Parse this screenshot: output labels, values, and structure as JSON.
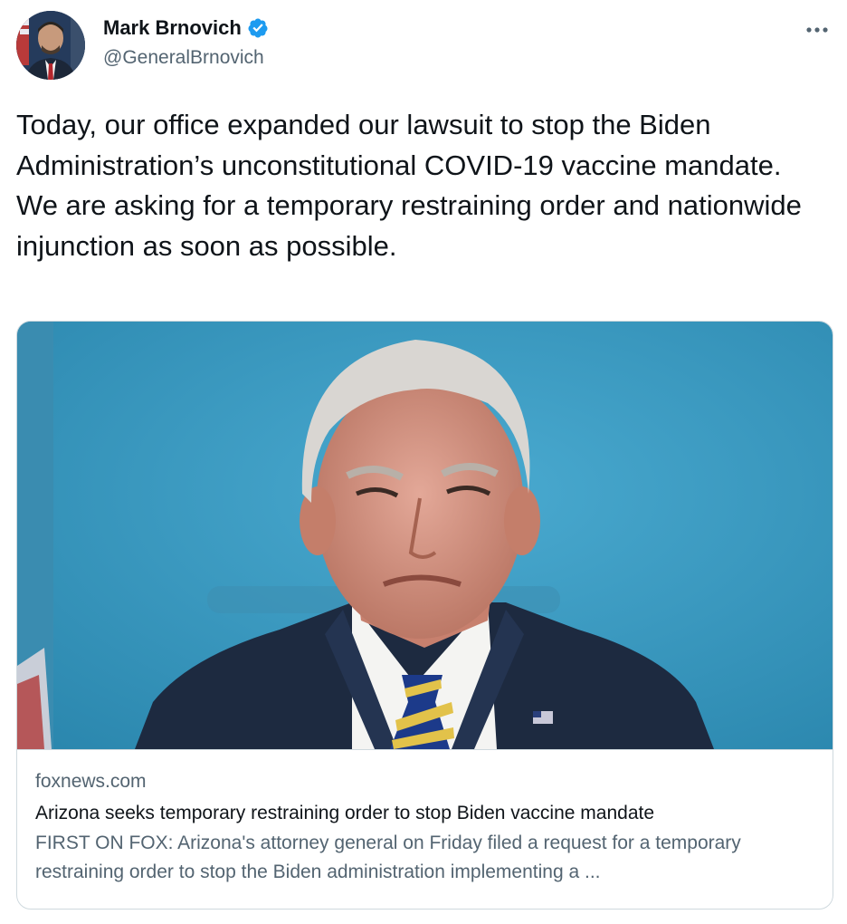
{
  "author": {
    "display_name": "Mark Brnovich",
    "handle": "@GeneralBrnovich",
    "verified": true,
    "avatar_icon": "profile-photo",
    "verified_icon": "verified-badge-icon"
  },
  "menu": {
    "icon": "more-horizontal-icon"
  },
  "tweet": {
    "text": "Today, our office expanded our lawsuit to stop the Biden Administration’s unconstitutional COVID-19 vaccine mandate. We are asking for a temporary restraining order and nationwide injunction as soon as possible."
  },
  "link_card": {
    "domain": "foxnews.com",
    "title": "Arizona seeks temporary restraining order to stop Biden vaccine mandate",
    "description": "FIRST ON FOX: Arizona's attorney general on Friday filed a request for a temporary restraining order to stop the Biden administration implementing a ..."
  },
  "colors": {
    "verified_blue": "#1d9bf0",
    "secondary_text": "#536471",
    "primary_text": "#0f1419",
    "border": "#cfd9de"
  }
}
